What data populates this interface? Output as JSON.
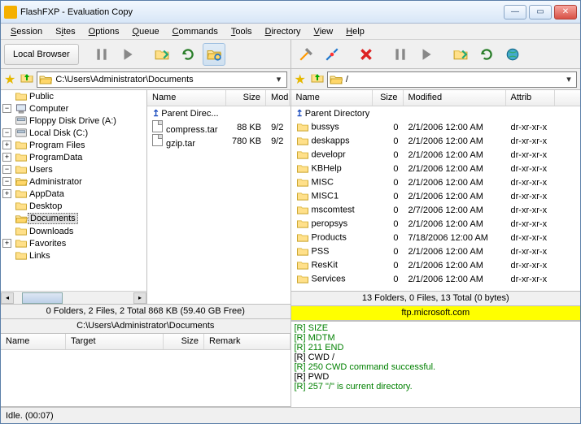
{
  "title": "FlashFXP - Evaluation Copy",
  "menu": [
    "Session",
    "Sites",
    "Options",
    "Queue",
    "Commands",
    "Tools",
    "Directory",
    "View",
    "Help"
  ],
  "local_browser_label": "Local Browser",
  "left_path": "C:\\Users\\Administrator\\Documents",
  "right_path": "/",
  "tree": {
    "root1": "Public",
    "root2": "Computer",
    "floppy": "Floppy Disk Drive (A:)",
    "localc": "Local Disk (C:)",
    "progfiles": "Program Files",
    "progdata": "ProgramData",
    "users": "Users",
    "admin": "Administrator",
    "appdata": "AppData",
    "desktop": "Desktop",
    "documents": "Documents",
    "downloads": "Downloads",
    "favorites": "Favorites",
    "links": "Links"
  },
  "left_cols": {
    "name": "Name",
    "size": "Size",
    "mod": "Mod"
  },
  "right_cols": {
    "name": "Name",
    "size": "Size",
    "modified": "Modified",
    "attrib": "Attrib"
  },
  "parent_dir_short": "Parent Direc...",
  "parent_dir": "Parent Directory",
  "left_files": [
    {
      "name": "compress.tar",
      "size": "88 KB",
      "mod": "9/2"
    },
    {
      "name": "gzip.tar",
      "size": "780 KB",
      "mod": "9/2"
    }
  ],
  "right_files": [
    {
      "name": "bussys",
      "size": "0",
      "mod": "2/1/2006 12:00 AM",
      "attr": "dr-xr-xr-x"
    },
    {
      "name": "deskapps",
      "size": "0",
      "mod": "2/1/2006 12:00 AM",
      "attr": "dr-xr-xr-x"
    },
    {
      "name": "developr",
      "size": "0",
      "mod": "2/1/2006 12:00 AM",
      "attr": "dr-xr-xr-x"
    },
    {
      "name": "KBHelp",
      "size": "0",
      "mod": "2/1/2006 12:00 AM",
      "attr": "dr-xr-xr-x"
    },
    {
      "name": "MISC",
      "size": "0",
      "mod": "2/1/2006 12:00 AM",
      "attr": "dr-xr-xr-x"
    },
    {
      "name": "MISC1",
      "size": "0",
      "mod": "2/1/2006 12:00 AM",
      "attr": "dr-xr-xr-x"
    },
    {
      "name": "mscomtest",
      "size": "0",
      "mod": "2/7/2006 12:00 AM",
      "attr": "dr-xr-xr-x"
    },
    {
      "name": "peropsys",
      "size": "0",
      "mod": "2/1/2006 12:00 AM",
      "attr": "dr-xr-xr-x"
    },
    {
      "name": "Products",
      "size": "0",
      "mod": "7/18/2006 12:00 AM",
      "attr": "dr-xr-xr-x"
    },
    {
      "name": "PSS",
      "size": "0",
      "mod": "2/1/2006 12:00 AM",
      "attr": "dr-xr-xr-x"
    },
    {
      "name": "ResKit",
      "size": "0",
      "mod": "2/1/2006 12:00 AM",
      "attr": "dr-xr-xr-x"
    },
    {
      "name": "Services",
      "size": "0",
      "mod": "2/1/2006 12:00 AM",
      "attr": "dr-xr-xr-x"
    }
  ],
  "left_status1": "0 Folders, 2 Files, 2 Total 868 KB (59.40 GB Free)",
  "left_status2": "C:\\Users\\Administrator\\Documents",
  "right_status1": "13 Folders, 0 Files, 13 Total (0 bytes)",
  "right_status2": "ftp.microsoft.com",
  "queue_cols": {
    "name": "Name",
    "target": "Target",
    "size": "Size",
    "remark": "Remark"
  },
  "log_lines": [
    {
      "c": "g",
      "t": "[R]     SIZE"
    },
    {
      "c": "g",
      "t": "[R]     MDTM"
    },
    {
      "c": "g",
      "t": "[R] 211 END"
    },
    {
      "c": "k",
      "t": "[R] CWD /"
    },
    {
      "c": "g",
      "t": "[R] 250 CWD command successful."
    },
    {
      "c": "k",
      "t": "[R] PWD"
    },
    {
      "c": "g",
      "t": "[R] 257 \"/\" is current directory."
    }
  ],
  "bottom_status": "Idle. (00:07)"
}
